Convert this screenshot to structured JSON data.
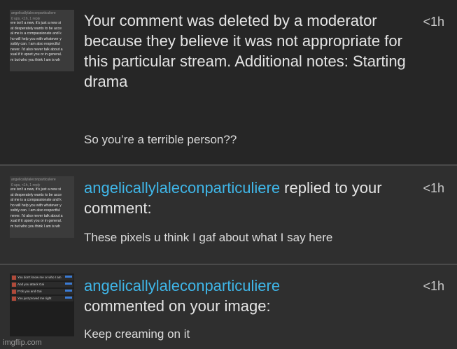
{
  "notifications": [
    {
      "message": "Your comment was deleted by a moderator because they believe it was not appropriate for this particular stream. Additional notes: Starting drama",
      "preview": "So you’re a terrible person??",
      "time": "<1h",
      "thumbnail": {
        "title": "angelicallylaleconparticuliere",
        "meta": "0 ups, <1h, 1 reply",
        "lines": [
          "ere isn't a new, it's just a new si",
          "at desperately wants to be acce",
          "al me is a compassionate and k",
          "ho will help you with whatever y",
          "ssibly can. I am also respectful",
          "never. I'd also never talk about a",
          "xual if it upset you or in general.",
          "m but who you think I am is wh"
        ]
      }
    },
    {
      "username": "angelicallylaleconparticuliere",
      "action": " replied to your comment:",
      "preview": "These pixels u think I gaf about what I say here",
      "time": "<1h",
      "thumbnail": {
        "title": "angelicallylaleconparticuliere",
        "meta": "0 ups, <1h, 1 reply",
        "lines": [
          "ere isn't a new, it's just a new si",
          "at desperately wants to be acce",
          "al me is a compassionate and k",
          "ho will help you with whatever y",
          "ssibly can. I am also respectful",
          "never. I'd also never talk about a",
          "xual if it upset you or in general.",
          "m but who you think I am is wh"
        ]
      }
    },
    {
      "username": "angelicallylaleconparticuliere",
      "action": "commented on your image:",
      "preview": "Keep creaming on it",
      "time": "<1h",
      "thumbnail": {
        "rows": [
          "You don't know me or who I am",
          "And you attack Gai",
          "F*ck you and Gai",
          "You just proved me right"
        ]
      }
    }
  ],
  "watermark": "imgflip.com",
  "colors": {
    "username": "#3fb6e8",
    "background": "#2e2e2e"
  }
}
